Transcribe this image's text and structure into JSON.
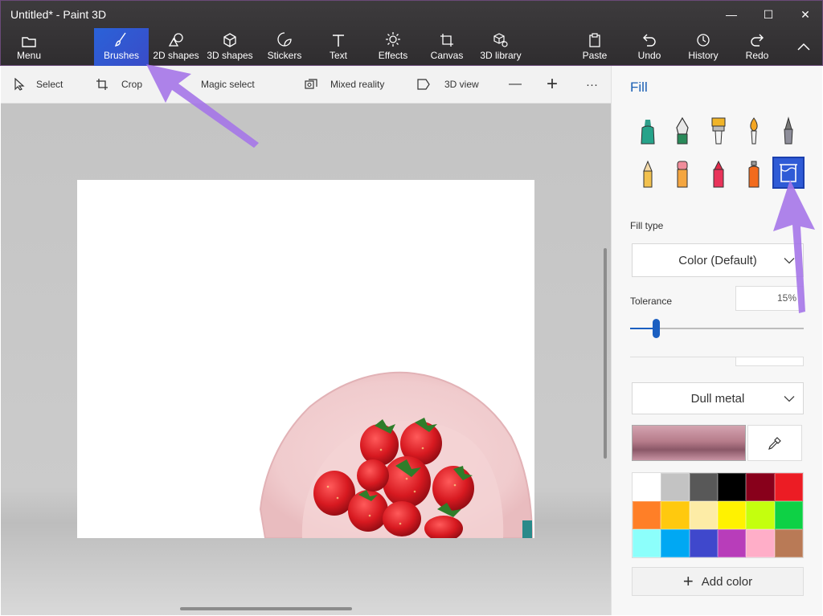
{
  "window": {
    "title": "Untitled* - Paint 3D",
    "minimize_glyph": "—",
    "maximize_glyph": "☐",
    "close_glyph": "✕"
  },
  "ribbon": {
    "menu": "Menu",
    "tabs": [
      {
        "label": "Brushes",
        "icon": "brush-icon",
        "active": true
      },
      {
        "label": "2D shapes",
        "icon": "2d-shapes-icon"
      },
      {
        "label": "3D shapes",
        "icon": "3d-shapes-icon"
      },
      {
        "label": "Stickers",
        "icon": "stickers-icon"
      },
      {
        "label": "Text",
        "icon": "text-icon"
      },
      {
        "label": "Effects",
        "icon": "effects-icon"
      },
      {
        "label": "Canvas",
        "icon": "canvas-icon"
      },
      {
        "label": "3D library",
        "icon": "3d-library-icon"
      }
    ],
    "actions": [
      {
        "label": "Paste",
        "icon": "paste-icon"
      },
      {
        "label": "Undo",
        "icon": "undo-icon"
      },
      {
        "label": "History",
        "icon": "history-icon"
      },
      {
        "label": "Redo",
        "icon": "redo-icon"
      }
    ],
    "collapse_glyph": "︿"
  },
  "toolbar": {
    "select": "Select",
    "crop": "Crop",
    "magic_select": "Magic select",
    "mixed_reality": "Mixed reality",
    "view_3d": "3D view",
    "zoom_out": "—",
    "zoom_in": "+",
    "more": "···"
  },
  "panel": {
    "title": "Fill",
    "tools": [
      {
        "icon": "marker-icon"
      },
      {
        "icon": "calligraphy-pen-icon"
      },
      {
        "icon": "oil-brush-icon"
      },
      {
        "icon": "watercolor-icon"
      },
      {
        "icon": "pixel-pen-icon"
      },
      {
        "icon": "pencil-icon"
      },
      {
        "icon": "eraser-icon"
      },
      {
        "icon": "crayon-icon"
      },
      {
        "icon": "spray-can-icon"
      },
      {
        "icon": "fill-bucket-icon",
        "selected": true
      }
    ],
    "fill_type_label": "Fill type",
    "fill_type_value": "Color (Default)",
    "tolerance_label": "Tolerance",
    "tolerance_value": "15%",
    "tolerance_level": 0.15,
    "material_value": "Dull metal",
    "current_color_gradient": [
      "#d3a4b0",
      "#8a5767"
    ],
    "palette": [
      "#ffffff",
      "#c3c3c3",
      "#585858",
      "#000000",
      "#88001b",
      "#ec1c24",
      "#ff7f27",
      "#ffc90e",
      "#fdeca6",
      "#fff200",
      "#c4ff0e",
      "#0ed145",
      "#8cfffb",
      "#00a8f3",
      "#3f48cc",
      "#b83dba",
      "#ffaec8",
      "#b97a56"
    ],
    "add_color": "Add color"
  }
}
